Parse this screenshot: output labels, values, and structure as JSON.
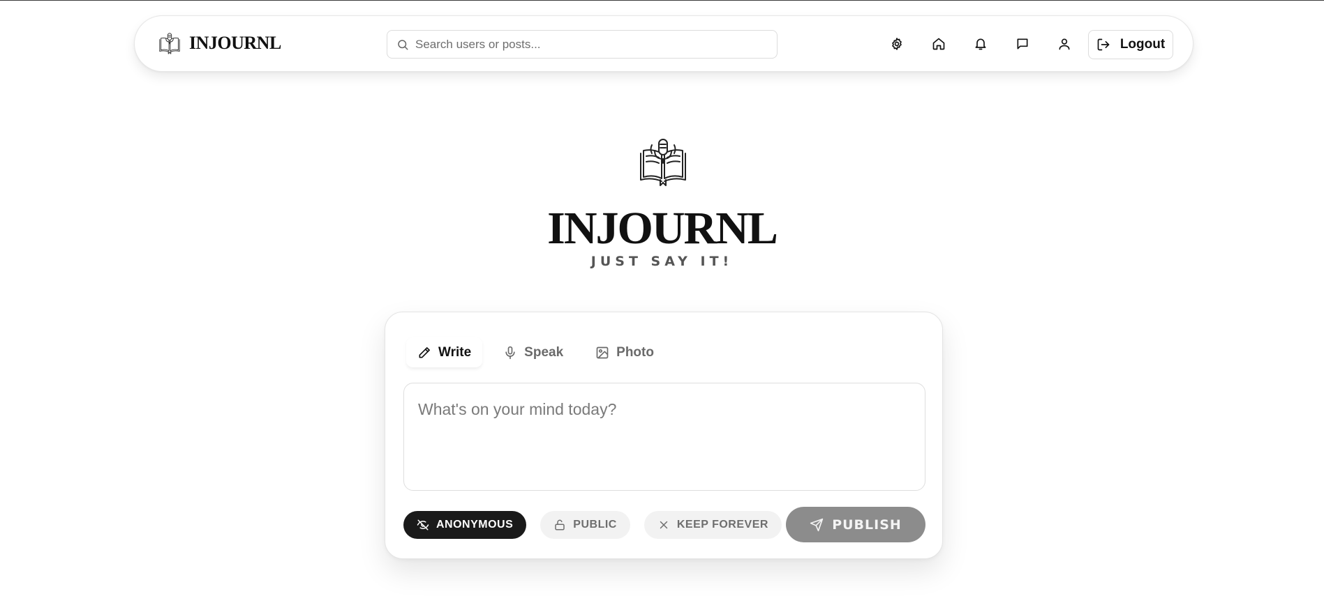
{
  "header": {
    "brand_name": "INJOURNL",
    "brand_icon": "book-microphone-icon",
    "search_placeholder": "Search users or posts...",
    "nav_icons": [
      "gear-icon",
      "home-icon",
      "bell-icon",
      "message-icon",
      "user-icon"
    ],
    "logout_label": "Logout"
  },
  "hero": {
    "title": "INJOURNL",
    "tagline": "JUST SAY IT!"
  },
  "composer": {
    "tabs": [
      {
        "label": "Write",
        "icon": "pencil-icon",
        "active": true
      },
      {
        "label": "Speak",
        "icon": "microphone-icon",
        "active": false
      },
      {
        "label": "Photo",
        "icon": "image-icon",
        "active": false
      }
    ],
    "placeholder": "What's on your mind today?",
    "options": [
      {
        "label": "ANONYMOUS",
        "icon": "eye-off-icon",
        "active": true
      },
      {
        "label": "PUBLIC",
        "icon": "unlock-icon",
        "active": false
      },
      {
        "label": "KEEP FOREVER",
        "icon": "close-icon",
        "active": false
      }
    ],
    "publish_label": "PUBLISH"
  },
  "colors": {
    "primary": "#1a1a1a",
    "publish_disabled": "#8c8c8c",
    "pill_light": "#f2f2f2"
  }
}
